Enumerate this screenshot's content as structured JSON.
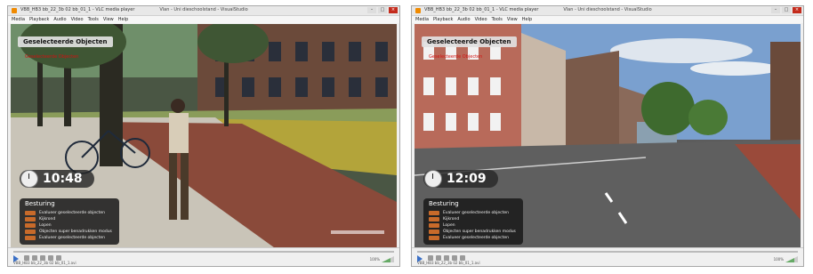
{
  "windows": [
    {
      "window_title": "VBB_HB3 bb_22_3b 02 bb_01_1 - VLC media player",
      "center_title": "Vlan - Uni dieschoolstand - VisualStudio",
      "menu": [
        "Media",
        "Playback",
        "Audio",
        "Video",
        "Tools",
        "View",
        "Help"
      ],
      "overlay_title": "Geselecteerde Objecten",
      "overlay_red": "Geselecteerde Objecten",
      "clock_time": "10:48",
      "panel_title": "Besturing",
      "panel_items": [
        "Evalueer geselecteerde objecten",
        "Kijkrond",
        "Lopen",
        "Objecten super benadrukken modus",
        "Evalueer geselecteerde objecten"
      ],
      "status": "VBB_HB3 bb_22_3b 02 bb_01_1.avi",
      "volume": "100%"
    },
    {
      "window_title": "VBB_HB3 bb_22_3b 02 bb_01_1 - VLC media player",
      "center_title": "Vlan - Uni dieschoolstand - VisualStudio",
      "menu": [
        "Media",
        "Playback",
        "Audio",
        "Video",
        "Tools",
        "View",
        "Help"
      ],
      "overlay_title": "Geselecteerde Objecten",
      "overlay_red": "Geselecteerde Objecten",
      "clock_time": "12:09",
      "panel_title": "Besturing",
      "panel_items": [
        "Evalueer geselecteerde objecten",
        "Kijkrond",
        "Lopen",
        "Objecten super benadrukken modus",
        "Evalueer geselecteerde objecten"
      ],
      "status": "VBB_HB3 bb_22_3b 02 bb_01_1.avi",
      "volume": "100%"
    }
  ],
  "colors": {
    "accent_orange": "#f08a00",
    "overlay_red": "#d21010",
    "play_blue": "#3a6fc6"
  }
}
